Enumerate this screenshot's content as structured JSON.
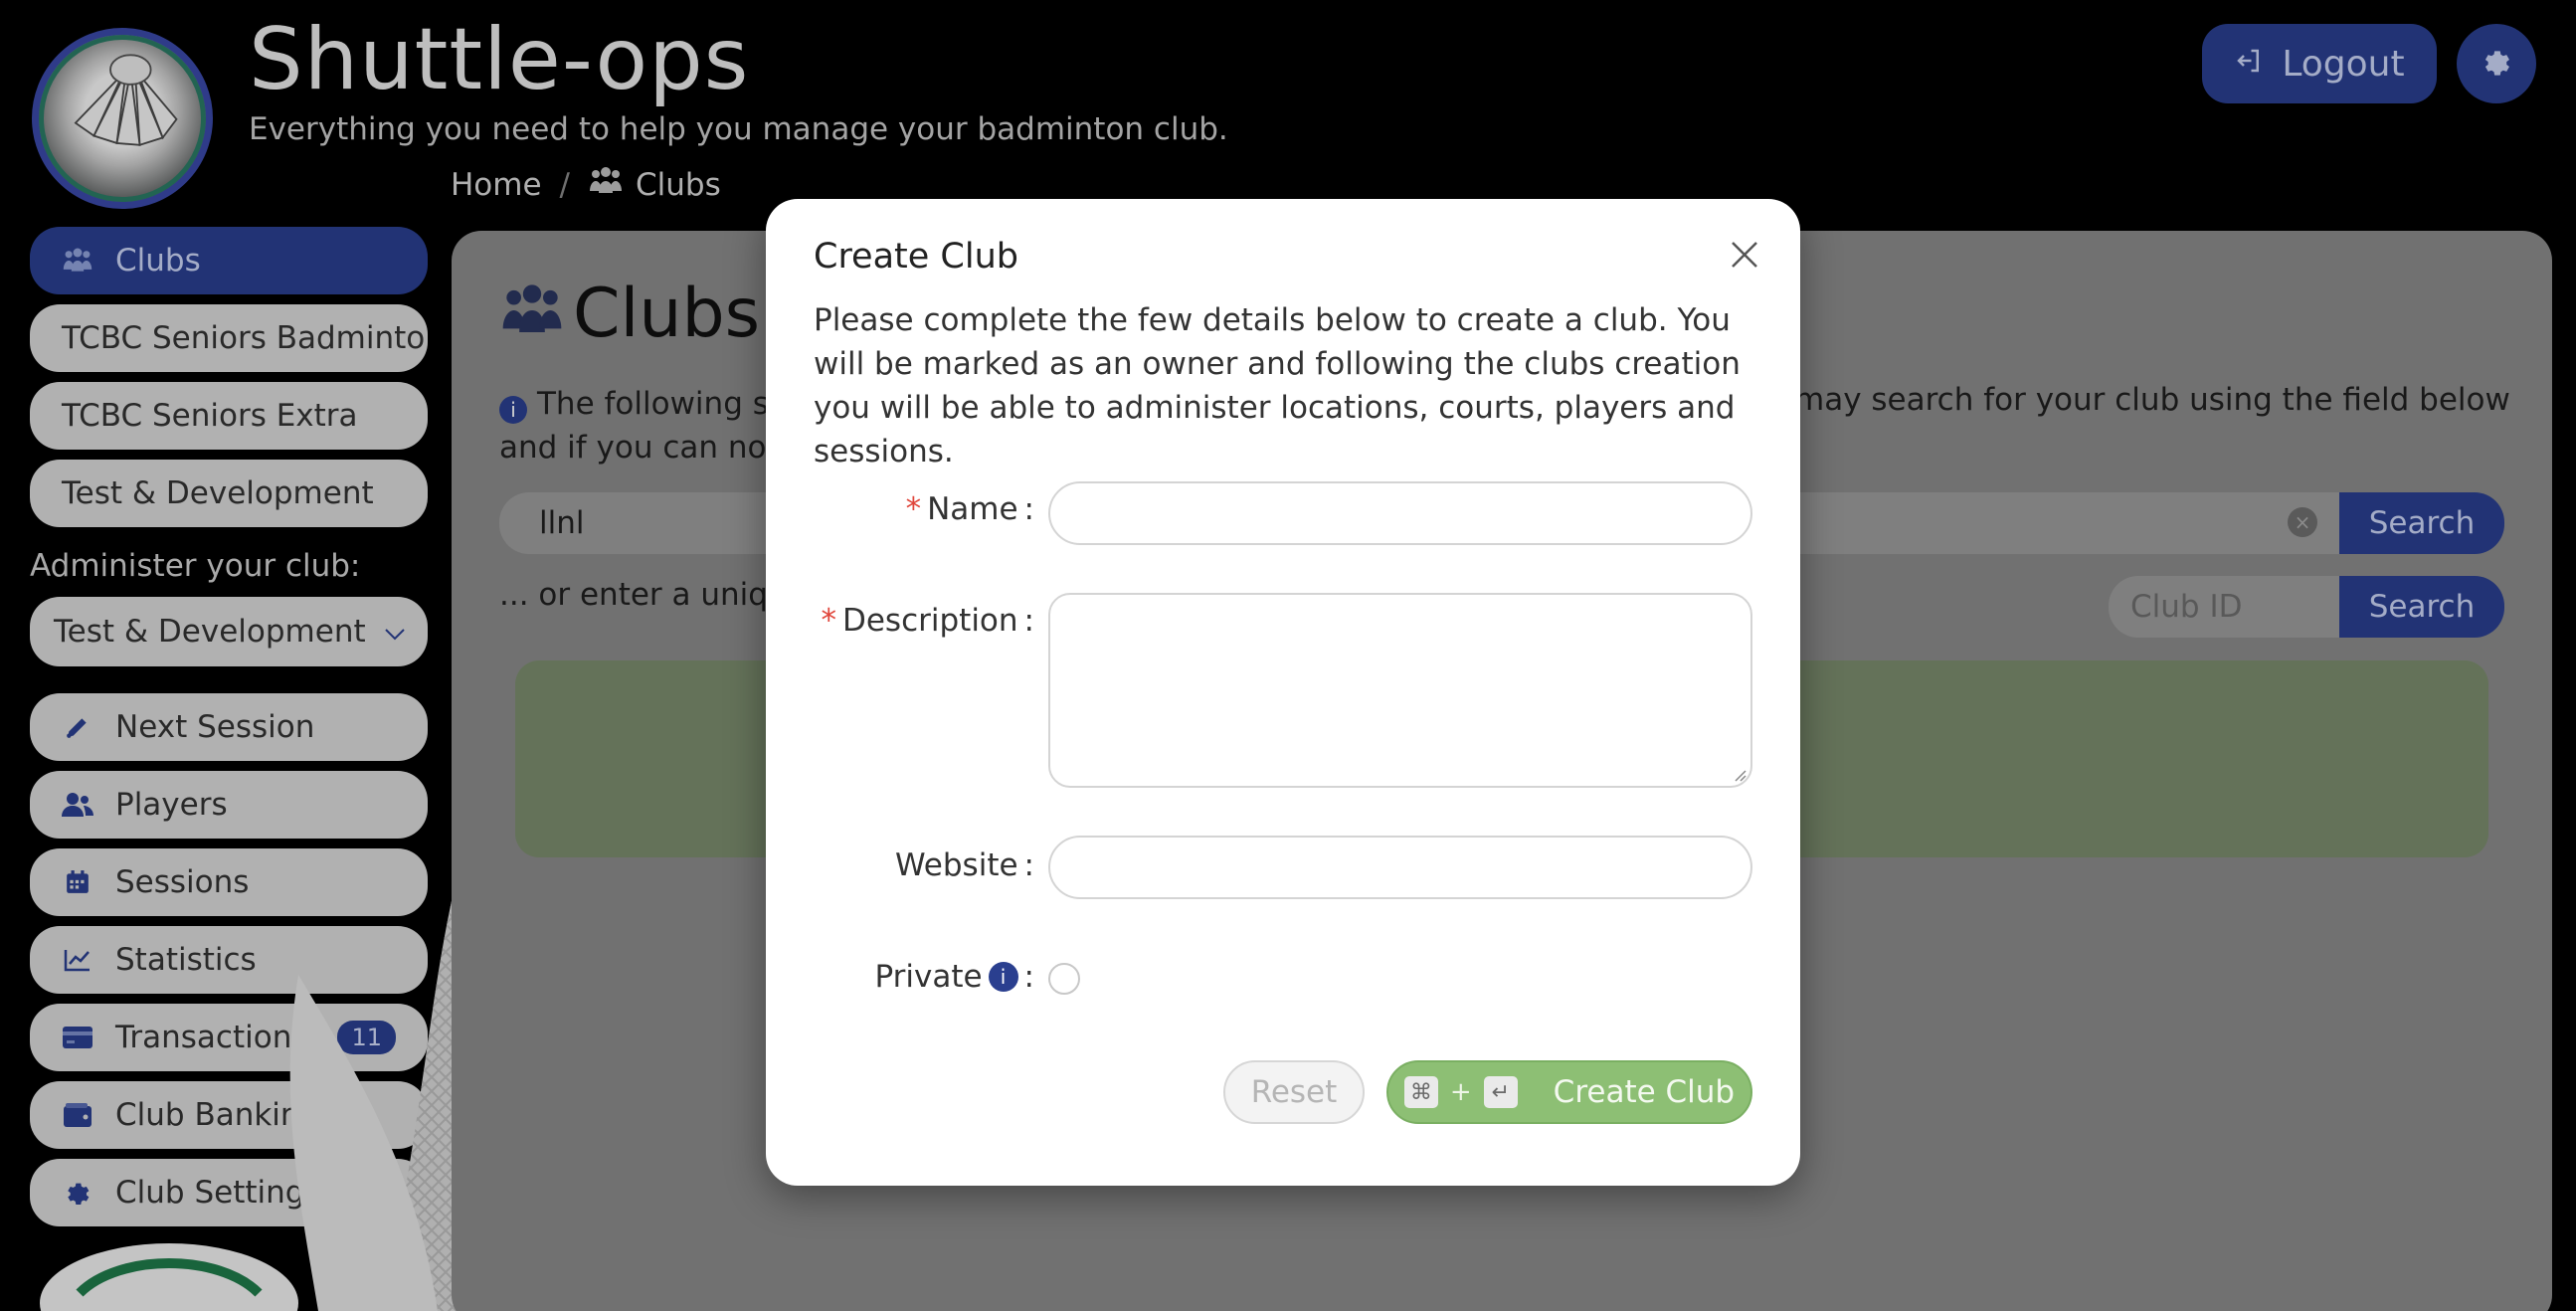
{
  "app": {
    "title": "Shuttle-ops",
    "subtitle": "Everything you need to help you manage your badminton club."
  },
  "header": {
    "logout_label": "Logout"
  },
  "breadcrumb": {
    "home": "Home",
    "separator": "/",
    "current": "Clubs"
  },
  "sidebar": {
    "items_top": [
      {
        "label": "Clubs",
        "icon": "users-icon",
        "active": true
      },
      {
        "label": "TCBC Seniors Badminton"
      },
      {
        "label": "TCBC Seniors Extra"
      },
      {
        "label": "Test & Development"
      }
    ],
    "admin_label": "Administer your club:",
    "admin_select_value": "Test & Development",
    "items_admin": [
      {
        "label": "Next Session",
        "icon": "shuttlecock-icon"
      },
      {
        "label": "Players",
        "icon": "players-icon"
      },
      {
        "label": "Sessions",
        "icon": "calendar-icon"
      },
      {
        "label": "Statistics",
        "icon": "chart-icon"
      },
      {
        "label": "Transactions",
        "icon": "credit-card-icon",
        "badge": "11"
      },
      {
        "label": "Club Banking",
        "icon": "wallet-icon"
      },
      {
        "label": "Club Settings",
        "icon": "gear-icon"
      }
    ]
  },
  "main": {
    "title": "Clubs",
    "info_start": "The following sh",
    "info_line2": "and if you can not",
    "info_tail": "may search for your club using the field below",
    "search_value": "llnl",
    "search_button": "Search",
    "or_text": "... or enter a unique",
    "club_id_placeholder": "Club ID",
    "club_id_button": "Search"
  },
  "modal": {
    "title": "Create Club",
    "description": "Please complete the few details below to create a club. You will be marked as an owner and following the clubs creation you will be able to administer locations, courts, players and sessions.",
    "required_mark": "*",
    "name_label": "Name",
    "description_label": "Description",
    "website_label": "Website",
    "private_label": "Private",
    "colon": ":",
    "name_value": "",
    "description_value": "",
    "website_value": "",
    "reset_label": "Reset",
    "create_label": "Create Club",
    "shortcut_plus": "+"
  },
  "colors": {
    "accent": "#2a3f8f",
    "create_button": "#8dbf74",
    "required": "#e0453a"
  }
}
